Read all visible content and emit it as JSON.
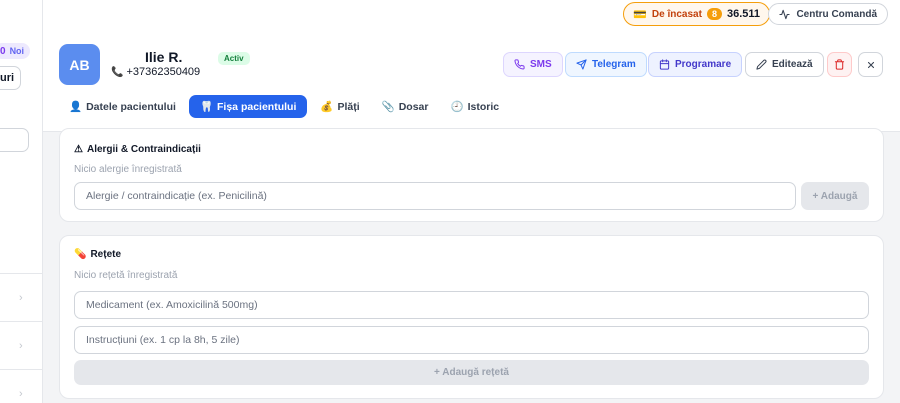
{
  "left": {
    "noi_count": "0",
    "noi_label": "Noi",
    "button_label": "uri",
    "chevron": "›"
  },
  "topbar": {
    "collect_icon": "💳",
    "collect_label": "De încasat",
    "collect_count": "8",
    "collect_amount": "36.511",
    "command_icon": "activity-icon",
    "command_label": "Centru Comandă"
  },
  "patient": {
    "initials": "AB",
    "name": "Ilie R.",
    "status": "Activ",
    "phone_icon": "📞",
    "phone": "+37362350409",
    "avatar_color": "#5b8def"
  },
  "actions": {
    "sms": "SMS",
    "telegram": "Telegram",
    "programare": "Programare",
    "editeaza": "Editează"
  },
  "tabs": [
    {
      "icon": "👤",
      "label": "Datele pacientului"
    },
    {
      "icon": "🦷",
      "label": "Fișa pacientului"
    },
    {
      "icon": "💰",
      "label": "Plăți"
    },
    {
      "icon": "📎",
      "label": "Dosar"
    },
    {
      "icon": "🕘",
      "label": "Istoric"
    }
  ],
  "allergies": {
    "icon": "⚠",
    "title": "Alergii & Contraindicații",
    "empty": "Nicio alergie înregistrată",
    "placeholder": "Alergie / contraindicație (ex. Penicilină)",
    "add": "+ Adaugă"
  },
  "prescriptions": {
    "icon": "💊",
    "title": "Rețete",
    "empty": "Nicio rețetă înregistrată",
    "medication_placeholder": "Medicament (ex. Amoxicilină 500mg)",
    "instructions_placeholder": "Instrucțiuni (ex. 1 cp la 8h, 5 zile)",
    "add": "+ Adaugă rețetă"
  },
  "colors": {
    "primary": "#2563eb",
    "accent_orange": "#f59e0b",
    "success": "#15803d",
    "danger": "#dc2626"
  }
}
